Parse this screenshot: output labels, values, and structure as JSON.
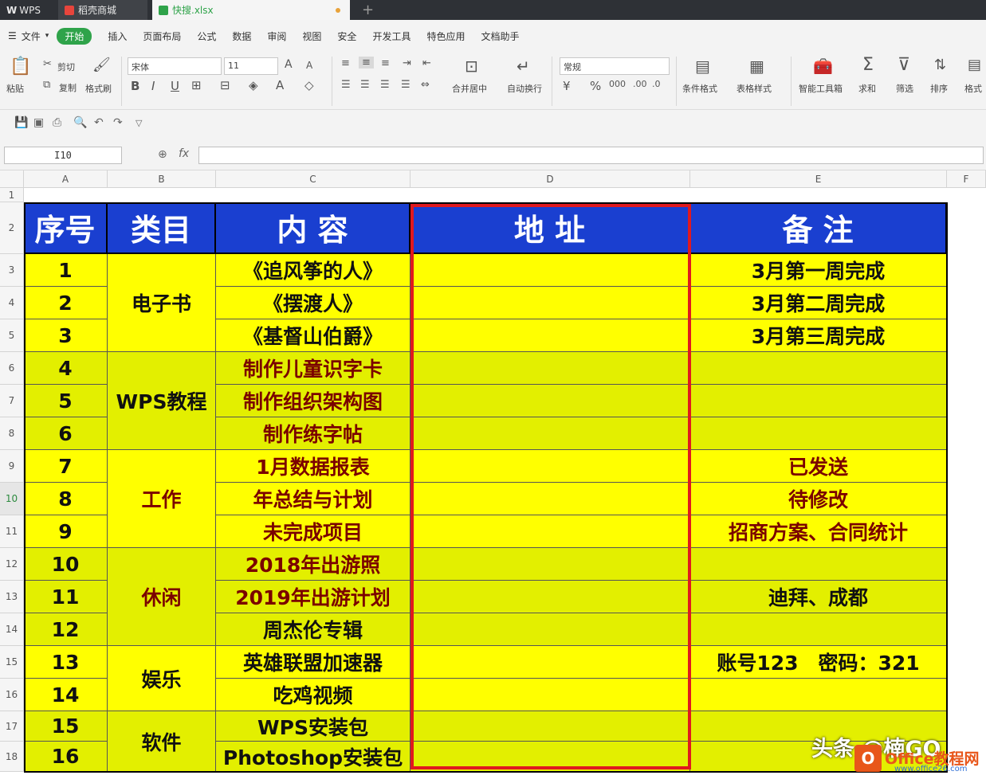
{
  "tabs": {
    "wps": "WPS",
    "shell": "稻壳商城",
    "file": "快搜.xlsx"
  },
  "menu": [
    "文件",
    "开始",
    "插入",
    "页面布局",
    "公式",
    "数据",
    "审阅",
    "视图",
    "安全",
    "开发工具",
    "特色应用",
    "文档助手"
  ],
  "ribbon": {
    "paste": "粘贴",
    "cut": "剪切",
    "copy": "复制",
    "format_painter": "格式刷",
    "font": "宋体",
    "font_size": "11",
    "number_format": "常规",
    "merge": "合并居中",
    "wrap": "自动换行",
    "cond_format": "条件格式",
    "table_style": "表格样式",
    "smart_toolbox": "智能工具箱",
    "sum": "求和",
    "filter": "筛选",
    "sort": "排序",
    "format": "格式"
  },
  "namebox": "I10",
  "columns": [
    "A",
    "B",
    "C",
    "D",
    "E",
    "F"
  ],
  "rows": [
    "1",
    "2",
    "3",
    "4",
    "5",
    "6",
    "7",
    "8",
    "9",
    "10",
    "11",
    "12",
    "13",
    "14",
    "15",
    "16",
    "17",
    "18"
  ],
  "header": {
    "no": "序号",
    "cat": "类目",
    "content": "内 容",
    "addr": "地 址",
    "note": "备 注"
  },
  "cats": [
    "电子书",
    "WPS教程",
    "工作",
    "休闲",
    "娱乐",
    "软件"
  ],
  "items": [
    {
      "no": "1",
      "content": "《追风筝的人》",
      "note": "3月第一周完成"
    },
    {
      "no": "2",
      "content": "《摆渡人》",
      "note": "3月第二周完成"
    },
    {
      "no": "3",
      "content": "《基督山伯爵》",
      "note": "3月第三周完成"
    },
    {
      "no": "4",
      "content": "制作儿童识字卡",
      "note": ""
    },
    {
      "no": "5",
      "content": "制作组织架构图",
      "note": ""
    },
    {
      "no": "6",
      "content": "制作练字帖",
      "note": ""
    },
    {
      "no": "7",
      "content": "1月数据报表",
      "note": "已发送"
    },
    {
      "no": "8",
      "content": "年总结与计划",
      "note": "待修改"
    },
    {
      "no": "9",
      "content": "未完成项目",
      "note": "招商方案、合同统计"
    },
    {
      "no": "10",
      "content": "2018年出游照",
      "note": ""
    },
    {
      "no": "11",
      "content": "2019年出游计划",
      "note": "迪拜、成都"
    },
    {
      "no": "12",
      "content": "周杰伦专辑",
      "note": ""
    },
    {
      "no": "13",
      "content": "英雄联盟加速器",
      "note": "账号123　密码：321"
    },
    {
      "no": "14",
      "content": "吃鸡视频",
      "note": ""
    },
    {
      "no": "15",
      "content": "WPS安装包",
      "note": ""
    },
    {
      "no": "16",
      "content": "Photoshop安装包",
      "note": ""
    }
  ],
  "watermark": "楠GO",
  "footer": {
    "text": "头条 @楠GO",
    "logo": "Office教程网",
    "url": "www.office26.com"
  }
}
